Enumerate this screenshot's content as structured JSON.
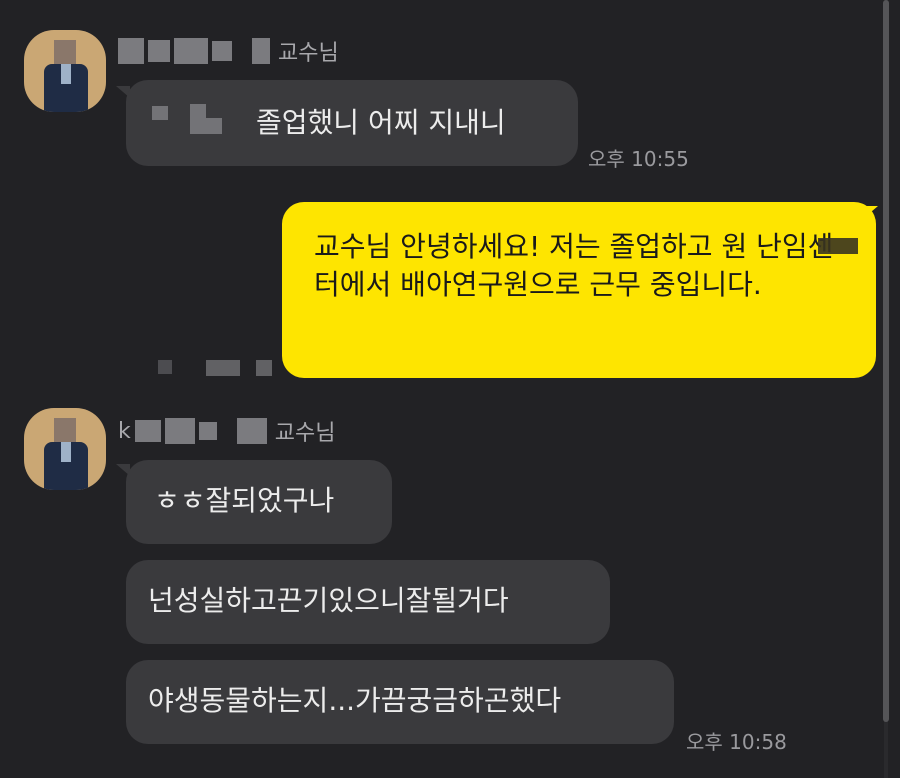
{
  "messages": {
    "group1": {
      "sender_suffix": "교수님",
      "text": "졸업했니 어찌 지내니",
      "time": "오후 10:55"
    },
    "mine": {
      "text": "교수님 안녕하세요! 저는 졸업하고 원 난임센터에서 배아연구원으로 근무 중입니다."
    },
    "group2": {
      "sender_prefix": "k",
      "sender_suffix": "교수님",
      "msg1": "ㅎㅎ잘되었구나",
      "msg2": "넌성실하고끈기있으니잘될거다",
      "msg3": "야생동물하는지...가끔궁금하곤했다",
      "time": "오후 10:58"
    }
  },
  "colors": {
    "background": "#222225",
    "incoming_bubble": "#3a3a3d",
    "outgoing_bubble": "#fee500"
  }
}
